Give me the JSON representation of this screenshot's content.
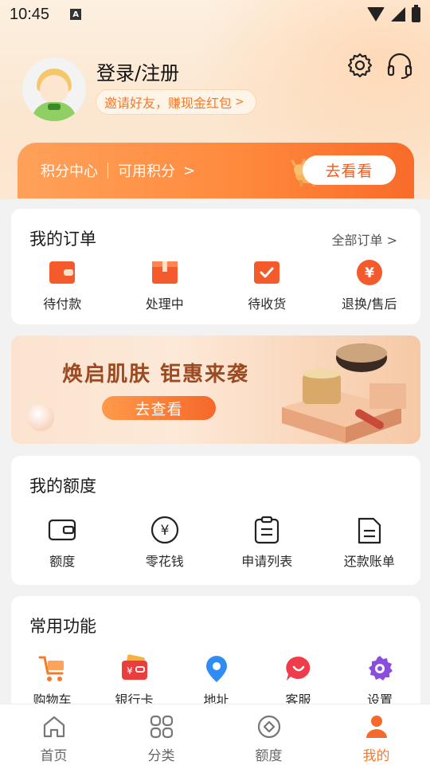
{
  "status_bar": {
    "time": "10:45",
    "app_indicator": "A"
  },
  "profile": {
    "login_label": "登录/注册",
    "invite_text": "邀请好友，赚现金红包",
    "invite_arrow": ">"
  },
  "points": {
    "center_label": "积分中心",
    "available_label": "可用积分",
    "chevron": ">",
    "button_label": "去看看"
  },
  "orders": {
    "title": "我的订单",
    "all_link": "全部订单 >",
    "items": [
      {
        "label": "待付款",
        "icon": "wallet-icon"
      },
      {
        "label": "处理中",
        "icon": "box-icon"
      },
      {
        "label": "待收货",
        "icon": "delivery-icon"
      },
      {
        "label": "退换/售后",
        "icon": "yuan-refund-icon"
      }
    ]
  },
  "banner": {
    "headline": "焕启肌肤  钜惠来袭",
    "button_label": "去查看"
  },
  "credit": {
    "title": "我的额度",
    "items": [
      {
        "label": "额度",
        "icon": "wallet-outline-icon"
      },
      {
        "label": "零花钱",
        "icon": "yuan-circle-icon"
      },
      {
        "label": "申请列表",
        "icon": "clipboard-icon"
      },
      {
        "label": "还款账单",
        "icon": "bill-icon"
      }
    ]
  },
  "tools": {
    "title": "常用功能",
    "items": [
      {
        "label": "购物车",
        "icon": "cart-icon"
      },
      {
        "label": "银行卡",
        "icon": "bank-card-icon"
      },
      {
        "label": "地址",
        "icon": "location-pin-icon"
      },
      {
        "label": "客服",
        "icon": "customer-service-icon"
      },
      {
        "label": "设置",
        "icon": "settings-gear-icon"
      }
    ]
  },
  "bottom_nav": {
    "items": [
      {
        "label": "首页",
        "icon": "home-icon"
      },
      {
        "label": "分类",
        "icon": "category-grid-icon"
      },
      {
        "label": "额度",
        "icon": "credit-icon"
      },
      {
        "label": "我的",
        "icon": "profile-icon"
      }
    ],
    "active_index": 3
  },
  "colors": {
    "accent": "#f47a2c",
    "points_gradient_start": "#ffa15a",
    "points_gradient_end": "#f96b2a",
    "banner_text": "#9b4a22"
  }
}
